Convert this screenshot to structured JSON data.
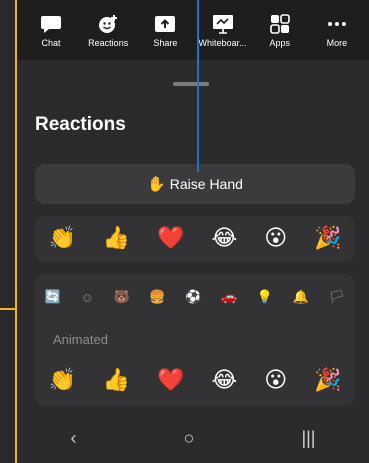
{
  "toolbar": {
    "items": [
      {
        "label": "Chat",
        "icon": "chat-icon"
      },
      {
        "label": "Reactions",
        "icon": "reactions-icon"
      },
      {
        "label": "Share",
        "icon": "share-icon"
      },
      {
        "label": "Whiteboar...",
        "icon": "whiteboard-icon"
      },
      {
        "label": "Apps",
        "icon": "apps-icon"
      },
      {
        "label": "More",
        "icon": "more-icon"
      }
    ]
  },
  "sheet": {
    "title": "Reactions",
    "raise_hand": {
      "emoji": "✋",
      "label": "Raise Hand"
    },
    "quick_reactions": [
      "👏",
      "👍",
      "❤️",
      "😂",
      "😮",
      "🎉"
    ],
    "categories": [
      "🔄",
      "☺",
      "🐻",
      "🍔",
      "⚽",
      "🚗",
      "💡",
      "🔔",
      "🏳"
    ],
    "section_label": "Animated",
    "animated_reactions": [
      "👏",
      "👍",
      "❤️",
      "😂",
      "😮",
      "🎉"
    ]
  },
  "navbar": {
    "back": "‹",
    "home": "○",
    "recent": "|||"
  },
  "colors": {
    "accent": "#f2b41a",
    "pointer": "#1e6fd9",
    "active_category": "#2d7ff9"
  }
}
